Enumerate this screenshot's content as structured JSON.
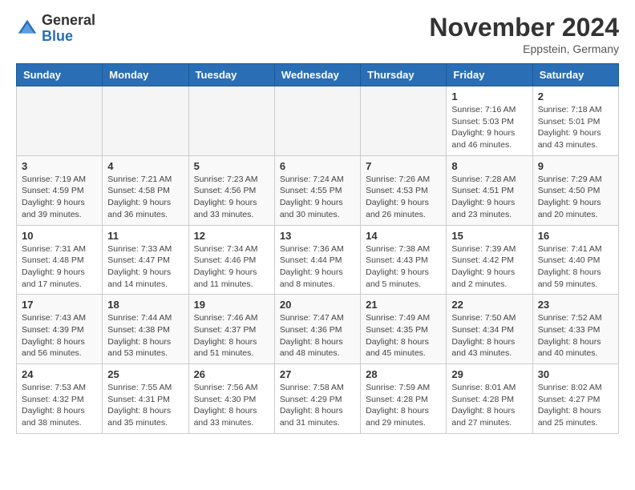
{
  "header": {
    "logo_general": "General",
    "logo_blue": "Blue",
    "month_title": "November 2024",
    "location": "Eppstein, Germany"
  },
  "columns": [
    "Sunday",
    "Monday",
    "Tuesday",
    "Wednesday",
    "Thursday",
    "Friday",
    "Saturday"
  ],
  "weeks": [
    [
      {
        "day": "",
        "info": ""
      },
      {
        "day": "",
        "info": ""
      },
      {
        "day": "",
        "info": ""
      },
      {
        "day": "",
        "info": ""
      },
      {
        "day": "",
        "info": ""
      },
      {
        "day": "1",
        "info": "Sunrise: 7:16 AM\nSunset: 5:03 PM\nDaylight: 9 hours\nand 46 minutes."
      },
      {
        "day": "2",
        "info": "Sunrise: 7:18 AM\nSunset: 5:01 PM\nDaylight: 9 hours\nand 43 minutes."
      }
    ],
    [
      {
        "day": "3",
        "info": "Sunrise: 7:19 AM\nSunset: 4:59 PM\nDaylight: 9 hours\nand 39 minutes."
      },
      {
        "day": "4",
        "info": "Sunrise: 7:21 AM\nSunset: 4:58 PM\nDaylight: 9 hours\nand 36 minutes."
      },
      {
        "day": "5",
        "info": "Sunrise: 7:23 AM\nSunset: 4:56 PM\nDaylight: 9 hours\nand 33 minutes."
      },
      {
        "day": "6",
        "info": "Sunrise: 7:24 AM\nSunset: 4:55 PM\nDaylight: 9 hours\nand 30 minutes."
      },
      {
        "day": "7",
        "info": "Sunrise: 7:26 AM\nSunset: 4:53 PM\nDaylight: 9 hours\nand 26 minutes."
      },
      {
        "day": "8",
        "info": "Sunrise: 7:28 AM\nSunset: 4:51 PM\nDaylight: 9 hours\nand 23 minutes."
      },
      {
        "day": "9",
        "info": "Sunrise: 7:29 AM\nSunset: 4:50 PM\nDaylight: 9 hours\nand 20 minutes."
      }
    ],
    [
      {
        "day": "10",
        "info": "Sunrise: 7:31 AM\nSunset: 4:48 PM\nDaylight: 9 hours\nand 17 minutes."
      },
      {
        "day": "11",
        "info": "Sunrise: 7:33 AM\nSunset: 4:47 PM\nDaylight: 9 hours\nand 14 minutes."
      },
      {
        "day": "12",
        "info": "Sunrise: 7:34 AM\nSunset: 4:46 PM\nDaylight: 9 hours\nand 11 minutes."
      },
      {
        "day": "13",
        "info": "Sunrise: 7:36 AM\nSunset: 4:44 PM\nDaylight: 9 hours\nand 8 minutes."
      },
      {
        "day": "14",
        "info": "Sunrise: 7:38 AM\nSunset: 4:43 PM\nDaylight: 9 hours\nand 5 minutes."
      },
      {
        "day": "15",
        "info": "Sunrise: 7:39 AM\nSunset: 4:42 PM\nDaylight: 9 hours\nand 2 minutes."
      },
      {
        "day": "16",
        "info": "Sunrise: 7:41 AM\nSunset: 4:40 PM\nDaylight: 8 hours\nand 59 minutes."
      }
    ],
    [
      {
        "day": "17",
        "info": "Sunrise: 7:43 AM\nSunset: 4:39 PM\nDaylight: 8 hours\nand 56 minutes."
      },
      {
        "day": "18",
        "info": "Sunrise: 7:44 AM\nSunset: 4:38 PM\nDaylight: 8 hours\nand 53 minutes."
      },
      {
        "day": "19",
        "info": "Sunrise: 7:46 AM\nSunset: 4:37 PM\nDaylight: 8 hours\nand 51 minutes."
      },
      {
        "day": "20",
        "info": "Sunrise: 7:47 AM\nSunset: 4:36 PM\nDaylight: 8 hours\nand 48 minutes."
      },
      {
        "day": "21",
        "info": "Sunrise: 7:49 AM\nSunset: 4:35 PM\nDaylight: 8 hours\nand 45 minutes."
      },
      {
        "day": "22",
        "info": "Sunrise: 7:50 AM\nSunset: 4:34 PM\nDaylight: 8 hours\nand 43 minutes."
      },
      {
        "day": "23",
        "info": "Sunrise: 7:52 AM\nSunset: 4:33 PM\nDaylight: 8 hours\nand 40 minutes."
      }
    ],
    [
      {
        "day": "24",
        "info": "Sunrise: 7:53 AM\nSunset: 4:32 PM\nDaylight: 8 hours\nand 38 minutes."
      },
      {
        "day": "25",
        "info": "Sunrise: 7:55 AM\nSunset: 4:31 PM\nDaylight: 8 hours\nand 35 minutes."
      },
      {
        "day": "26",
        "info": "Sunrise: 7:56 AM\nSunset: 4:30 PM\nDaylight: 8 hours\nand 33 minutes."
      },
      {
        "day": "27",
        "info": "Sunrise: 7:58 AM\nSunset: 4:29 PM\nDaylight: 8 hours\nand 31 minutes."
      },
      {
        "day": "28",
        "info": "Sunrise: 7:59 AM\nSunset: 4:28 PM\nDaylight: 8 hours\nand 29 minutes."
      },
      {
        "day": "29",
        "info": "Sunrise: 8:01 AM\nSunset: 4:28 PM\nDaylight: 8 hours\nand 27 minutes."
      },
      {
        "day": "30",
        "info": "Sunrise: 8:02 AM\nSunset: 4:27 PM\nDaylight: 8 hours\nand 25 minutes."
      }
    ]
  ]
}
